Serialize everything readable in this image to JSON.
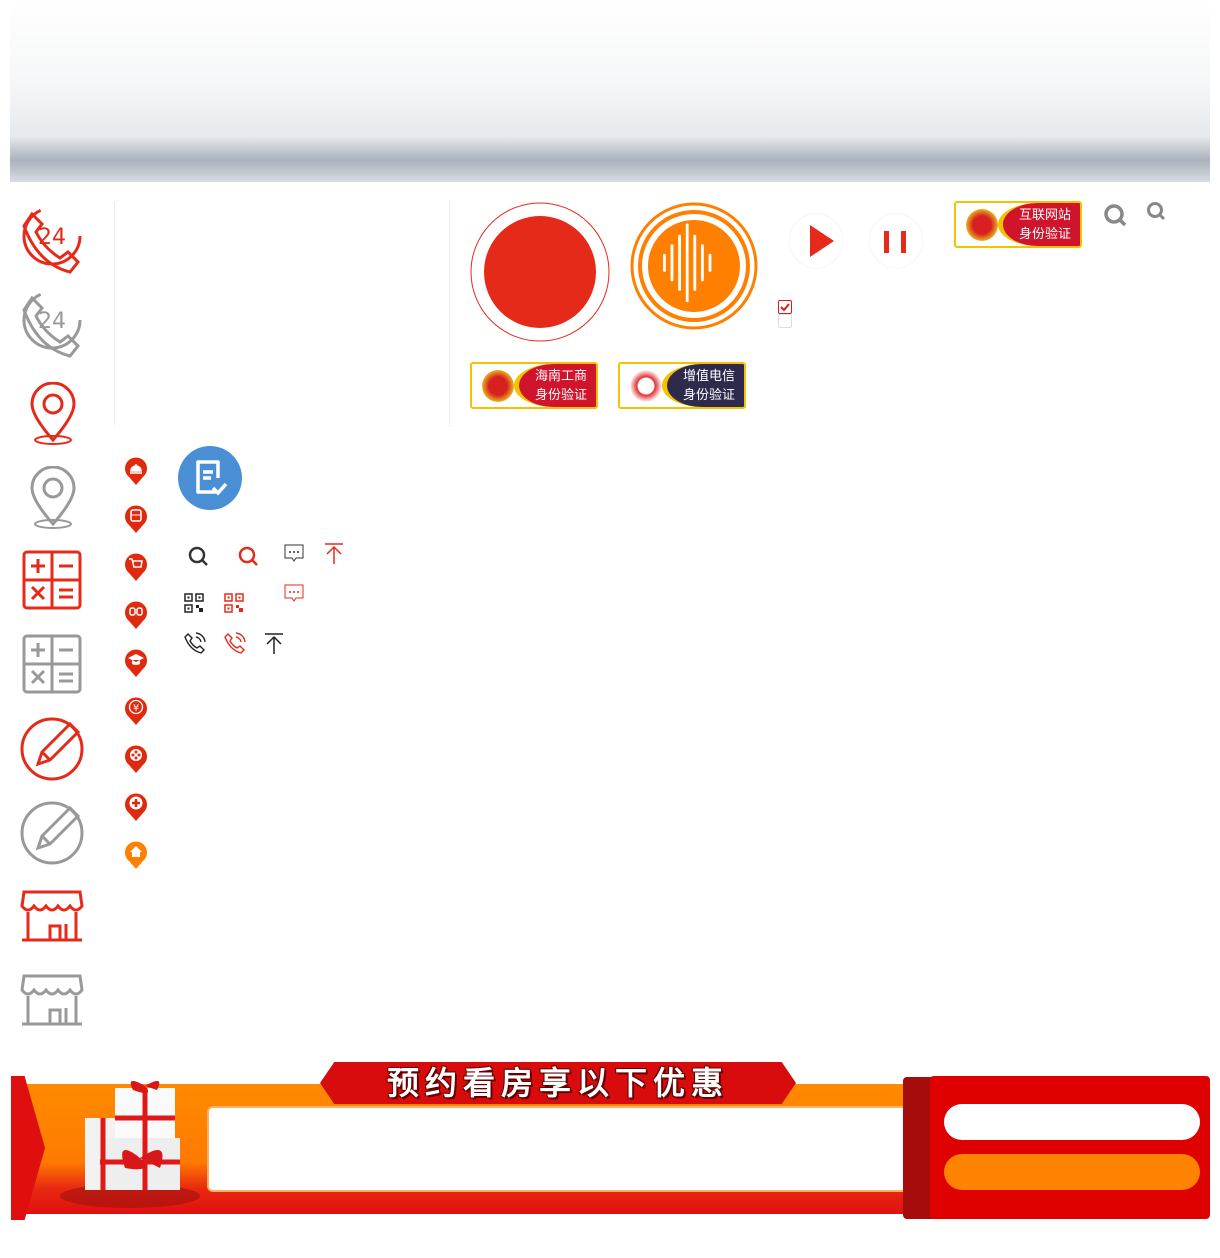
{
  "badges": [
    {
      "line1": "互联网站",
      "line2": "身份验证",
      "color": "#d0142c"
    },
    {
      "line1": "海南工商",
      "line2": "身份验证",
      "color": "#d0142c"
    },
    {
      "line1": "增值电信",
      "line2": "身份验证",
      "color": "#2e2a4c"
    }
  ],
  "checkbox": {
    "checked": true,
    "unchecked": false
  },
  "promo": {
    "title": "预约看房享以下优惠"
  },
  "colors": {
    "red": "#e52a1a",
    "orange": "#ff7f00",
    "grey": "#999999",
    "blue": "#4a8fd6",
    "dark_red": "#d80c0c"
  },
  "icons": [
    "phone-24",
    "location-pin",
    "calculator",
    "pencil",
    "store",
    "record",
    "voice-wave",
    "play",
    "pause",
    "search",
    "bell-pin",
    "bus-pin",
    "cart-pin",
    "link-pin",
    "graduation-pin",
    "yuan-pin",
    "film-pin",
    "medical-pin",
    "home-pin",
    "document-check",
    "chat",
    "back-to-top",
    "qr-code",
    "phone-call"
  ]
}
